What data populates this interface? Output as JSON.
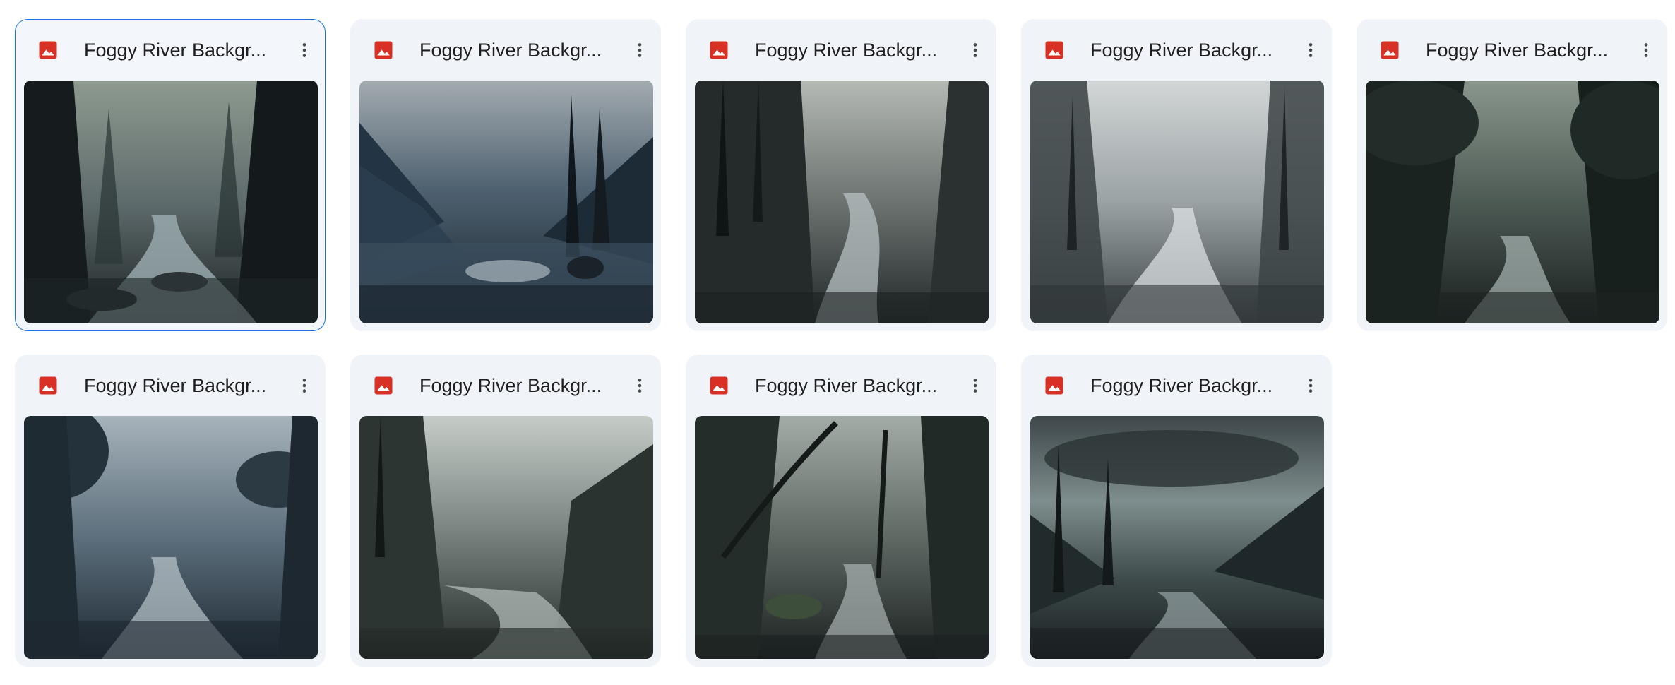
{
  "files": [
    {
      "name": "Foggy River Backgr...",
      "selected": true
    },
    {
      "name": "Foggy River Backgr...",
      "selected": false
    },
    {
      "name": "Foggy River Backgr...",
      "selected": false
    },
    {
      "name": "Foggy River Backgr...",
      "selected": false
    },
    {
      "name": "Foggy River Backgr...",
      "selected": false
    },
    {
      "name": "Foggy River Backgr...",
      "selected": false
    },
    {
      "name": "Foggy River Backgr...",
      "selected": false
    },
    {
      "name": "Foggy River Backgr...",
      "selected": false
    },
    {
      "name": "Foggy River Backgr...",
      "selected": false
    }
  ],
  "icons": {
    "file_type": "image-file-icon",
    "menu": "more-vert-icon"
  },
  "colors": {
    "image_icon": "#d93025",
    "selection": "#1a73e8",
    "card_bg": "#f0f4f9"
  }
}
